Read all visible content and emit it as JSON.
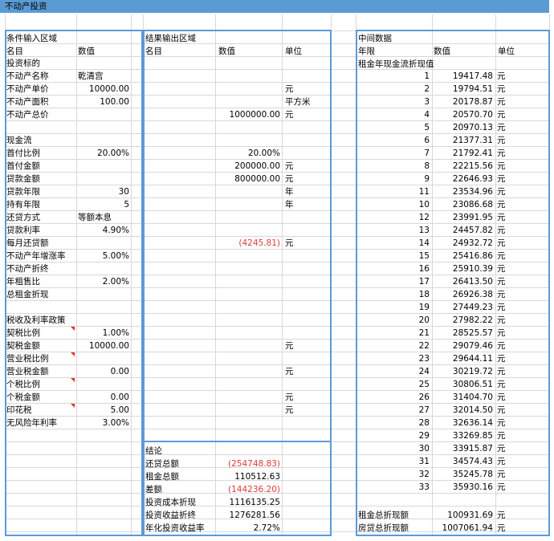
{
  "title": "不动产投资",
  "input": {
    "header": "条件输入区域",
    "col_name": "名目",
    "col_value": "数值",
    "rows": [
      {
        "label": "投资标的",
        "value": ""
      },
      {
        "label": "不动产名称",
        "value": "乾清宫"
      },
      {
        "label": "不动产单价",
        "value": "10000.00"
      },
      {
        "label": "不动产面积",
        "value": "100.00"
      },
      {
        "label": "不动产总价",
        "value": ""
      },
      {
        "label": "",
        "value": ""
      },
      {
        "label": "现金流",
        "value": ""
      },
      {
        "label": "首付比例",
        "value": "20.00%"
      },
      {
        "label": "首付金额",
        "value": ""
      },
      {
        "label": "贷款金额",
        "value": ""
      },
      {
        "label": "贷款年限",
        "value": "30"
      },
      {
        "label": "持有年限",
        "value": "5"
      },
      {
        "label": "还贷方式",
        "value": "等额本息"
      },
      {
        "label": "贷款利率",
        "value": "4.90%"
      },
      {
        "label": "每月还贷额",
        "value": ""
      },
      {
        "label": "不动产年增涨率",
        "value": "5.00%"
      },
      {
        "label": "不动产折终",
        "value": ""
      },
      {
        "label": "年租售比",
        "value": "2.00%"
      },
      {
        "label": "总租金折现",
        "value": ""
      },
      {
        "label": "",
        "value": ""
      },
      {
        "label": "税收及利率政策",
        "value": ""
      },
      {
        "label": "契税比例",
        "value": "1.00%"
      },
      {
        "label": "契税金额",
        "value": "10000.00"
      },
      {
        "label": "营业税比例",
        "value": ""
      },
      {
        "label": "营业税金额",
        "value": "0.00"
      },
      {
        "label": "个税比例",
        "value": ""
      },
      {
        "label": "个税金额",
        "value": "0.00"
      },
      {
        "label": "印花税",
        "value": "5.00"
      },
      {
        "label": "无风险年利率",
        "value": "3.00%"
      }
    ]
  },
  "output": {
    "header": "结果输出区域",
    "col_name": "名目",
    "col_value": "数值",
    "col_unit": "单位",
    "rows": [
      {
        "value": "",
        "unit": ""
      },
      {
        "value": "",
        "unit": ""
      },
      {
        "value": "",
        "unit": "元"
      },
      {
        "value": "",
        "unit": "平方米"
      },
      {
        "value": "1000000.00",
        "unit": "元"
      },
      {
        "value": "",
        "unit": ""
      },
      {
        "value": "",
        "unit": ""
      },
      {
        "value": "20.00%",
        "unit": ""
      },
      {
        "value": "200000.00",
        "unit": "元"
      },
      {
        "value": "800000.00",
        "unit": "元"
      },
      {
        "value": "",
        "unit": "年"
      },
      {
        "value": "",
        "unit": "年"
      },
      {
        "value": "",
        "unit": ""
      },
      {
        "value": "",
        "unit": ""
      },
      {
        "value": "(4245.81)",
        "unit": "元"
      },
      {
        "value": "",
        "unit": ""
      },
      {
        "value": "",
        "unit": ""
      },
      {
        "value": "",
        "unit": ""
      },
      {
        "value": "",
        "unit": ""
      },
      {
        "value": "",
        "unit": ""
      },
      {
        "value": "",
        "unit": ""
      },
      {
        "value": "",
        "unit": ""
      },
      {
        "value": "",
        "unit": "元"
      },
      {
        "value": "",
        "unit": ""
      },
      {
        "value": "",
        "unit": "元"
      },
      {
        "value": "",
        "unit": ""
      },
      {
        "value": "",
        "unit": "元"
      },
      {
        "value": "",
        "unit": "元"
      },
      {
        "value": "",
        "unit": ""
      }
    ]
  },
  "conclusion": {
    "header": "结论",
    "rows": [
      {
        "label": "还贷总额",
        "value": "(254748.83)"
      },
      {
        "label": "租金总额",
        "value": "110512.63"
      },
      {
        "label": "差额",
        "value": "(144236.20)"
      },
      {
        "label": "投资成本折现",
        "value": "1116135.25"
      },
      {
        "label": "投资收益折终",
        "value": "1276281.56"
      },
      {
        "label": "年化投资收益率",
        "value": "2.72%"
      }
    ]
  },
  "intermediate": {
    "header": "中间数据",
    "col_year": "年限",
    "col_value": "数值",
    "col_unit": "单位",
    "sub_header": "租金年现金流折现值",
    "unit": "元",
    "rows": [
      {
        "year": "1",
        "value": "19417.48"
      },
      {
        "year": "2",
        "value": "19794.51"
      },
      {
        "year": "3",
        "value": "20178.87"
      },
      {
        "year": "4",
        "value": "20570.70"
      },
      {
        "year": "5",
        "value": "20970.13"
      },
      {
        "year": "6",
        "value": "21377.31"
      },
      {
        "year": "7",
        "value": "21792.41"
      },
      {
        "year": "8",
        "value": "22215.56"
      },
      {
        "year": "9",
        "value": "22646.93"
      },
      {
        "year": "11",
        "value": "23534.96"
      },
      {
        "year": "10",
        "value": "23086.68"
      },
      {
        "year": "12",
        "value": "23991.95"
      },
      {
        "year": "13",
        "value": "24457.82"
      },
      {
        "year": "14",
        "value": "24932.72"
      },
      {
        "year": "15",
        "value": "25416.86"
      },
      {
        "year": "16",
        "value": "25910.39"
      },
      {
        "year": "17",
        "value": "26413.50"
      },
      {
        "year": "18",
        "value": "26926.38"
      },
      {
        "year": "19",
        "value": "27449.23"
      },
      {
        "year": "20",
        "value": "27982.22"
      },
      {
        "year": "21",
        "value": "28525.57"
      },
      {
        "year": "22",
        "value": "29079.46"
      },
      {
        "year": "23",
        "value": "29644.11"
      },
      {
        "year": "24",
        "value": "30219.72"
      },
      {
        "year": "25",
        "value": "30806.51"
      },
      {
        "year": "26",
        "value": "31404.70"
      },
      {
        "year": "27",
        "value": "32014.50"
      },
      {
        "year": "28",
        "value": "32636.14"
      },
      {
        "year": "29",
        "value": "33269.85"
      },
      {
        "year": "30",
        "value": "33915.87"
      },
      {
        "year": "31",
        "value": "34574.43"
      },
      {
        "year": "32",
        "value": "35245.78"
      },
      {
        "year": "33",
        "value": "35930.16"
      }
    ],
    "totals": [
      {
        "label": "租金总折现额",
        "value": "100931.69",
        "unit": "元"
      },
      {
        "label": "房贷总折现额",
        "value": "1007061.94",
        "unit": "元"
      }
    ]
  }
}
